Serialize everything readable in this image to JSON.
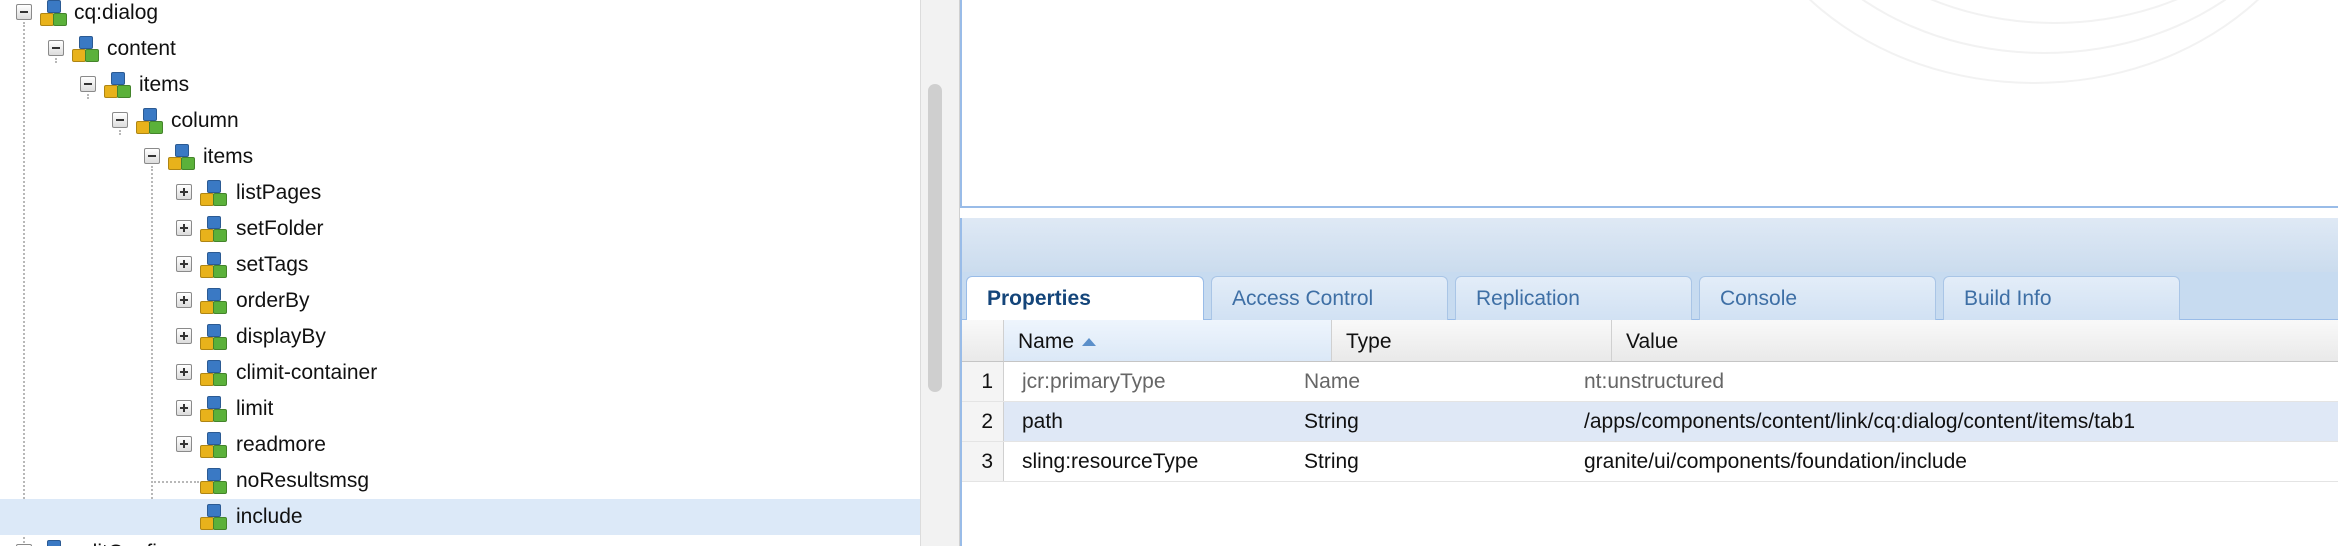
{
  "tree": {
    "nodes": [
      {
        "label": "cq:dialog",
        "toggle": "minus"
      },
      {
        "label": "content",
        "toggle": "minus"
      },
      {
        "label": "items",
        "toggle": "minus"
      },
      {
        "label": "column",
        "toggle": "minus"
      },
      {
        "label": "items",
        "toggle": "minus"
      },
      {
        "label": "listPages",
        "toggle": "plus"
      },
      {
        "label": "setFolder",
        "toggle": "plus"
      },
      {
        "label": "setTags",
        "toggle": "plus"
      },
      {
        "label": "orderBy",
        "toggle": "plus"
      },
      {
        "label": "displayBy",
        "toggle": "plus"
      },
      {
        "label": "climit-container",
        "toggle": "plus"
      },
      {
        "label": "limit",
        "toggle": "plus"
      },
      {
        "label": "readmore",
        "toggle": "plus"
      },
      {
        "label": "noResultsmsg",
        "toggle": "none"
      },
      {
        "label": "include",
        "toggle": "none",
        "selected": true
      },
      {
        "label": "editConfig",
        "toggle": "minus"
      }
    ]
  },
  "tabs": [
    {
      "label": "Properties",
      "active": true
    },
    {
      "label": "Access Control"
    },
    {
      "label": "Replication"
    },
    {
      "label": "Console"
    },
    {
      "label": "Build Info"
    }
  ],
  "grid": {
    "columns": {
      "name": "Name",
      "type": "Type",
      "value": "Value"
    },
    "sorted_column": "Name",
    "sort_direction": "ascending",
    "rows": [
      {
        "num": "1",
        "name": "jcr:primaryType",
        "type": "Name",
        "value": "nt:unstructured",
        "protected": true
      },
      {
        "num": "2",
        "name": "path",
        "type": "String",
        "value": "/apps/components/content/link/cq:dialog/content/items/tab1",
        "selected": true
      },
      {
        "num": "3",
        "name": "sling:resourceType",
        "type": "String",
        "value": "granite/ui/components/foundation/include"
      }
    ]
  },
  "colors": {
    "accent_border": "#99bce8",
    "tab_active_text": "#14457a",
    "tab_text": "#3e6fa5",
    "selection": "#dce9f8"
  }
}
